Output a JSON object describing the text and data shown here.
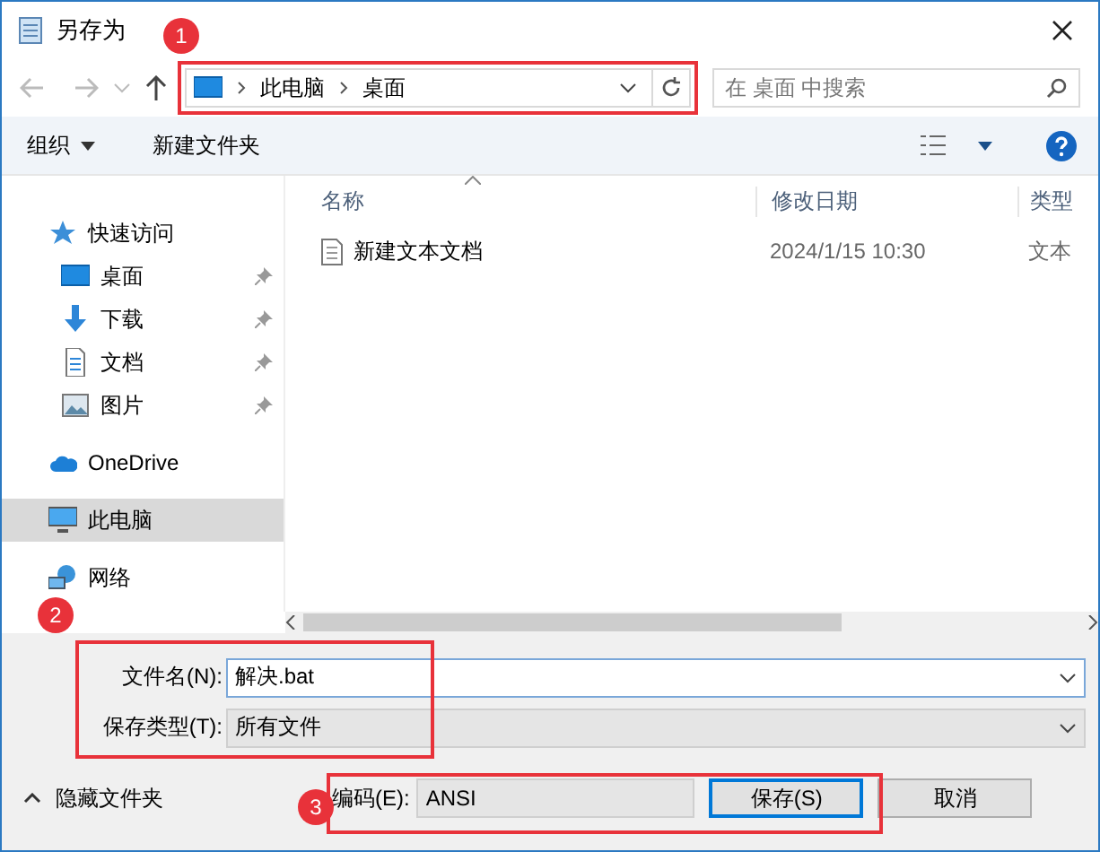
{
  "window": {
    "title": "另存为"
  },
  "address_bar": {
    "path": [
      "此电脑",
      "桌面"
    ]
  },
  "search": {
    "placeholder": "在 桌面 中搜索"
  },
  "toolbar": {
    "organize": "组织",
    "new_folder": "新建文件夹"
  },
  "sidebar": {
    "items": [
      {
        "label": "快速访问",
        "kind": "star",
        "selected": false,
        "children": [
          {
            "label": "桌面",
            "kind": "desktop",
            "pinned": true,
            "selected": false
          },
          {
            "label": "下载",
            "kind": "download",
            "pinned": true,
            "selected": false
          },
          {
            "label": "文档",
            "kind": "document",
            "pinned": true,
            "selected": false
          },
          {
            "label": "图片",
            "kind": "picture",
            "pinned": true,
            "selected": false
          }
        ]
      },
      {
        "label": "OneDrive",
        "kind": "cloud",
        "selected": false
      },
      {
        "label": "此电脑",
        "kind": "computer",
        "selected": true
      },
      {
        "label": "网络",
        "kind": "network",
        "selected": false
      }
    ]
  },
  "table": {
    "columns": [
      "名称",
      "修改日期",
      "类型"
    ],
    "rows": [
      {
        "name": "新建文本文档",
        "date": "2024/1/15 10:30",
        "type": "文本"
      }
    ]
  },
  "file_name": {
    "label": "文件名(N):",
    "value": "解决.bat"
  },
  "save_type": {
    "label": "保存类型(T):",
    "value": "所有文件"
  },
  "hide_folders": "隐藏文件夹",
  "encoding": {
    "label": "编码(E):",
    "value": "ANSI"
  },
  "buttons": [
    {
      "label": "保存(S)",
      "kind": "primary"
    },
    {
      "label": "取消",
      "kind": "normal"
    }
  ],
  "annotations": [
    "1",
    "2",
    "3"
  ]
}
